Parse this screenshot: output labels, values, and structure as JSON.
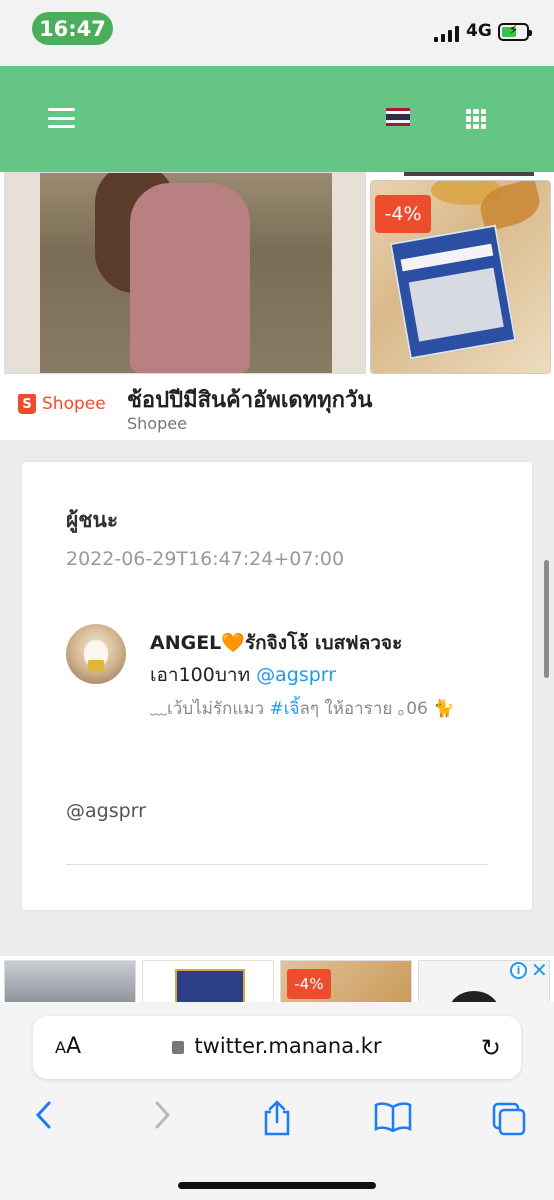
{
  "status_bar": {
    "time": "16:47",
    "network": "4G",
    "accent": "#4cae5c"
  },
  "header": {
    "bg_color": "#64c584",
    "menu_icon": "hamburger-icon",
    "flag_icon": "thailand-flag-icon",
    "apps_icon": "grid-icon"
  },
  "ad": {
    "discount_badge": "-4%",
    "brand": "Shopee",
    "title": "ช้อปปีมีสินค้าอัพเดททุกวัน",
    "subtitle": "Shopee",
    "brand_color": "#ee4d2d"
  },
  "post": {
    "heading": "ผู้ชนะ",
    "timestamp": "2022-06-29T16:47:24+07:00",
    "user": {
      "name_line1": "ANGEL🧡รักจิงโจ้ เบสฟลวจะ",
      "name_line2_prefix": "เอา100บาท ",
      "name_line2_mention": "@agsprr",
      "bio_prefix": "﹏เว้บไม่รักแมว ",
      "bio_hashtag": "#เจ",
      "bio_suffix": "ิ้ลๆ ให้อาราย ｡06 🐈"
    },
    "handle": "@agsprr"
  },
  "bottom_ad": {
    "discount_badge": "-4%",
    "adchoices_icon": "info-icon",
    "close_icon": "close-icon"
  },
  "browser": {
    "text_size_label": "AA",
    "url": "twitter.manana.kr",
    "reload_icon": "reload-icon",
    "back_icon": "back-chevron-icon",
    "forward_icon": "forward-chevron-icon",
    "share_icon": "share-icon",
    "bookmarks_icon": "bookmarks-icon",
    "tabs_icon": "tabs-icon"
  }
}
